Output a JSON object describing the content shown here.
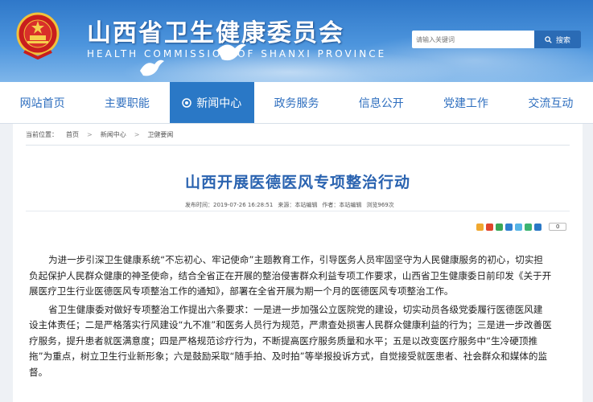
{
  "header": {
    "site_title": "山西省卫生健康委员会",
    "site_subtitle": "HEALTH COMMISSION OF SHANXI PROVINCE",
    "search_placeholder": "请输入关键词",
    "search_button": "搜索"
  },
  "nav": {
    "items": [
      {
        "label": "网站首页"
      },
      {
        "label": "主要职能"
      },
      {
        "label": "新闻中心"
      },
      {
        "label": "政务服务"
      },
      {
        "label": "信息公开"
      },
      {
        "label": "党建工作"
      },
      {
        "label": "交流互动"
      }
    ],
    "active_index": 2
  },
  "breadcrumb": {
    "prefix": "当前位置：",
    "items": [
      "首页",
      "新闻中心",
      "卫健要闻"
    ],
    "separator": ">"
  },
  "article": {
    "title": "山西开展医德医风专项整治行动",
    "meta": {
      "date_label": "发布时间：",
      "date": "2019-07-26 16:28:51",
      "author_label": "来源：",
      "author": "本站编辑",
      "source_label": "作者：",
      "source": "本站编辑",
      "views": "浏览969次"
    },
    "share_count": "0",
    "paragraphs": [
      "为进一步引深卫生健康系统“不忘初心、牢记使命”主题教育工作，引导医务人员牢固坚守为人民健康服务的初心，切实担负起保护人民群众健康的神圣使命，结合全省正在开展的整治侵害群众利益专项工作要求，山西省卫生健康委日前印发《关于开展医疗卫生行业医德医风专项整治工作的通知》，部署在全省开展为期一个月的医德医风专项整治工作。",
      "省卫生健康委对做好专项整治工作提出六条要求：一是进一步加强公立医院党的建设，切实动员各级党委履行医德医风建设主体责任；二是严格落实行风建设“九不准”和医务人员行为规范，严肃查处损害人民群众健康利益的行为；三是进一步改善医疗服务，提升患者就医满意度；四是严格规范诊疗行为，不断提高医疗服务质量和水平；五是以改变医疗服务中“生冷硬顶推拖”为重点，树立卫生行业新形象；六是鼓励采取“随手拍、及时拍”等举报投诉方式，自觉接受就医患者、社会群众和媒体的监督。"
    ]
  },
  "colors": {
    "banner_top": "#2f78c9",
    "nav_active": "#2a78c6",
    "nav_text": "#2f6fbf",
    "title": "#2a63b0"
  },
  "icons": {
    "emblem": "national-emblem",
    "search": "search-icon",
    "nav_active": "nav-circle-icon",
    "share": [
      "share-qzone-icon",
      "share-weibo-icon",
      "share-douban-icon",
      "share-renren-icon",
      "share-tqq-icon",
      "share-wechat-icon",
      "share-more-icon"
    ]
  }
}
